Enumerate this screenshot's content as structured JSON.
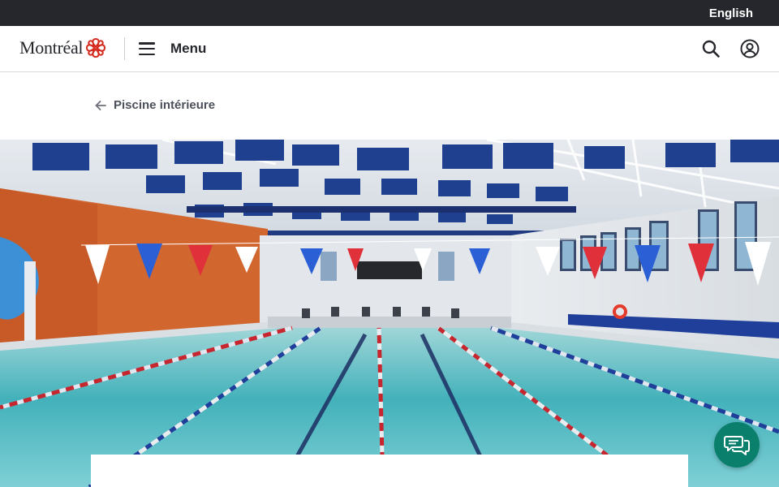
{
  "topbar": {
    "language_link": "English"
  },
  "header": {
    "logo_text": "Montréal",
    "menu_label": "Menu",
    "search_icon": "search-icon",
    "account_icon": "user-circle-icon"
  },
  "breadcrumb": {
    "back_icon": "arrow-left-icon",
    "label": "Piscine intérieure"
  },
  "hero": {
    "image_subject": "indoor swimming pool with lane ropes and pennant flags"
  },
  "chat": {
    "icon": "chat-bubbles-icon"
  },
  "colors": {
    "topbar_bg": "#25272c",
    "logo_red": "#d52b1e",
    "chat_accent": "#0a7f6c",
    "text_dark": "#25272c"
  }
}
